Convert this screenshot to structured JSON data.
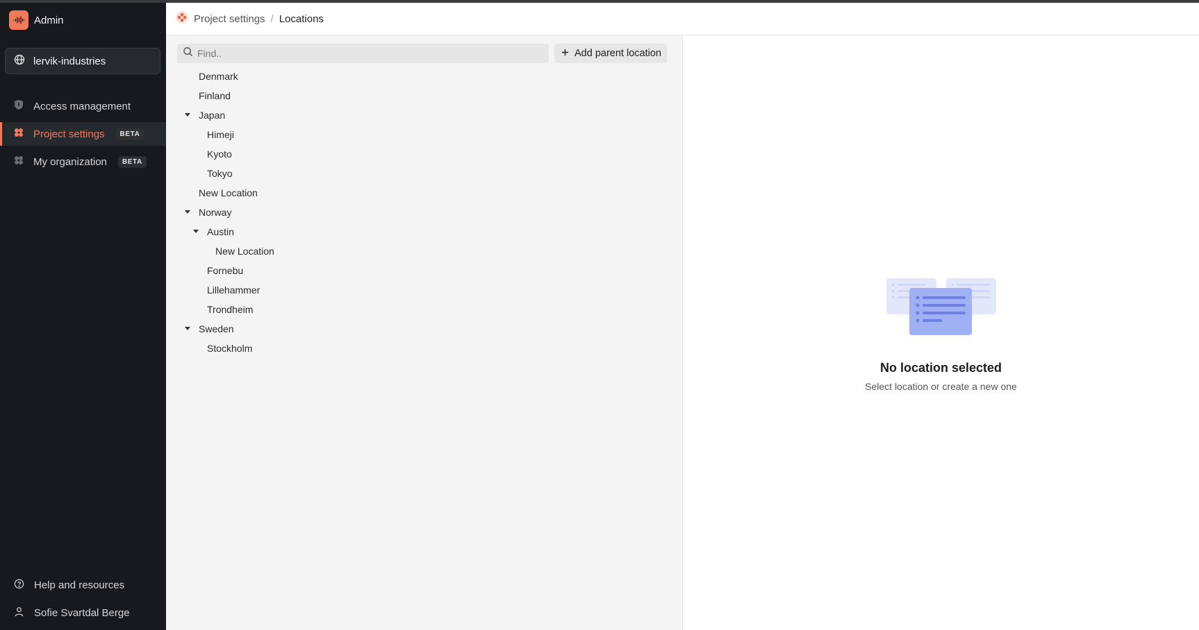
{
  "app": {
    "title": "Admin",
    "logo_color": "#f27a5a"
  },
  "project": {
    "name": "lervik-industries",
    "icon": "globe-icon"
  },
  "nav": {
    "items": [
      {
        "label": "Access management",
        "icon": "shield-icon",
        "badge": ""
      },
      {
        "label": "Project settings",
        "icon": "project-settings-icon",
        "badge": "BETA",
        "active": true
      },
      {
        "label": "My organization",
        "icon": "organization-icon",
        "badge": "BETA"
      }
    ],
    "bottom": [
      {
        "label": "Help and resources",
        "icon": "help-icon"
      },
      {
        "label": "Sofie Svartdal Berge",
        "icon": "user-icon"
      }
    ]
  },
  "breadcrumb": {
    "parent": "Project settings",
    "separator": "/",
    "current": "Locations"
  },
  "search": {
    "placeholder": "Find..",
    "value": ""
  },
  "toolbar": {
    "add_label": "Add parent location"
  },
  "tree": [
    {
      "label": "Denmark",
      "level": 0,
      "expanded": false,
      "has_children": false
    },
    {
      "label": "Finland",
      "level": 0,
      "expanded": false,
      "has_children": false
    },
    {
      "label": "Japan",
      "level": 0,
      "expanded": true,
      "has_children": true
    },
    {
      "label": "Himeji",
      "level": 1,
      "has_children": false
    },
    {
      "label": "Kyoto",
      "level": 1,
      "has_children": false
    },
    {
      "label": "Tokyo",
      "level": 1,
      "has_children": false
    },
    {
      "label": "New Location",
      "level": 0,
      "has_children": false
    },
    {
      "label": "Norway",
      "level": 0,
      "expanded": true,
      "has_children": true
    },
    {
      "label": "Austin",
      "level": 1,
      "expanded": true,
      "has_children": true
    },
    {
      "label": "New Location",
      "level": 2,
      "has_children": false
    },
    {
      "label": "Fornebu",
      "level": 1,
      "has_children": false
    },
    {
      "label": "Lillehammer",
      "level": 1,
      "has_children": false
    },
    {
      "label": "Trondheim",
      "level": 1,
      "has_children": false
    },
    {
      "label": "Sweden",
      "level": 0,
      "expanded": true,
      "has_children": true
    },
    {
      "label": "Stockholm",
      "level": 1,
      "has_children": false
    }
  ],
  "empty_state": {
    "title": "No location selected",
    "subtitle": "Select location or create a new one",
    "accent": "#8fa2f2"
  }
}
